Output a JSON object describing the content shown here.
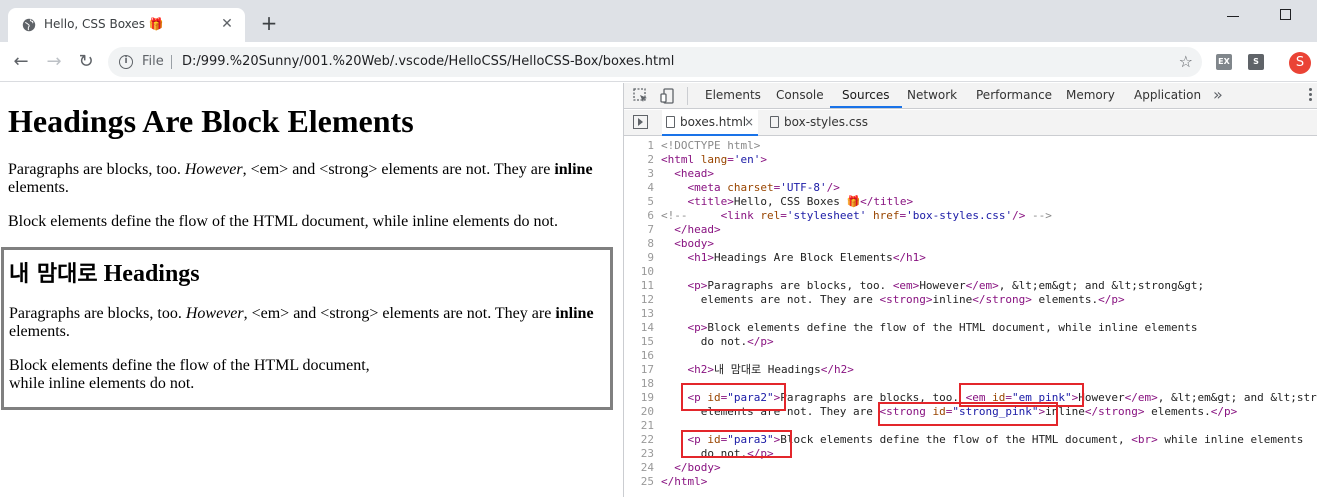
{
  "browser": {
    "tab_title": "Hello, CSS Boxes 🎁",
    "new_tab_label": "+",
    "scheme": "File",
    "url": "D:/999.%20Sunny/001.%20Web/.vscode/HelloCSS/HelloCSS-Box/boxes.html",
    "avatar_letter": "S",
    "ext1": "EX",
    "ext2": "S"
  },
  "page": {
    "h1": "Headings Are Block Elements",
    "p1": {
      "pre": "Paragraphs are blocks, too. ",
      "em": "However",
      "mid": ", <em> and <strong> elements are not. They are ",
      "strong": "inline",
      "post": " elements."
    },
    "p2": "Block elements define the flow of the HTML document, while inline elements do not.",
    "h2_korean": "내 맘대로",
    "h2_english": "Headings",
    "para2": {
      "pre": "Paragraphs are blocks, too. ",
      "em": "However",
      "mid": ", <em> and <strong> elements are not. They are ",
      "strong": "inline",
      "post": " elements."
    },
    "para3_line1": "Block elements define the flow of the HTML document,",
    "para3_line2": "while inline elements do not."
  },
  "devtools": {
    "tabs": [
      "Elements",
      "Console",
      "Sources",
      "Network",
      "Performance",
      "Memory",
      "Application"
    ],
    "active_tab": "Sources",
    "more_label": "»",
    "files": [
      {
        "name": "boxes.html",
        "close": "×"
      },
      {
        "name": "box-styles.css"
      }
    ],
    "line_numbers": [
      "1",
      "2",
      "3",
      "4",
      "5",
      "6",
      "7",
      "8",
      "9",
      "10",
      "11",
      "12",
      "13",
      "14",
      "15",
      "16",
      "17",
      "18",
      "19",
      "20",
      "21",
      "22",
      "23",
      "24",
      "25"
    ]
  },
  "colors": {
    "highlight_border": "#e3262b",
    "tag": "#881280",
    "attr": "#994500",
    "value": "#1a1aa6",
    "comment": "#8a8a8a",
    "active_tab_underline": "#1a73e8"
  }
}
